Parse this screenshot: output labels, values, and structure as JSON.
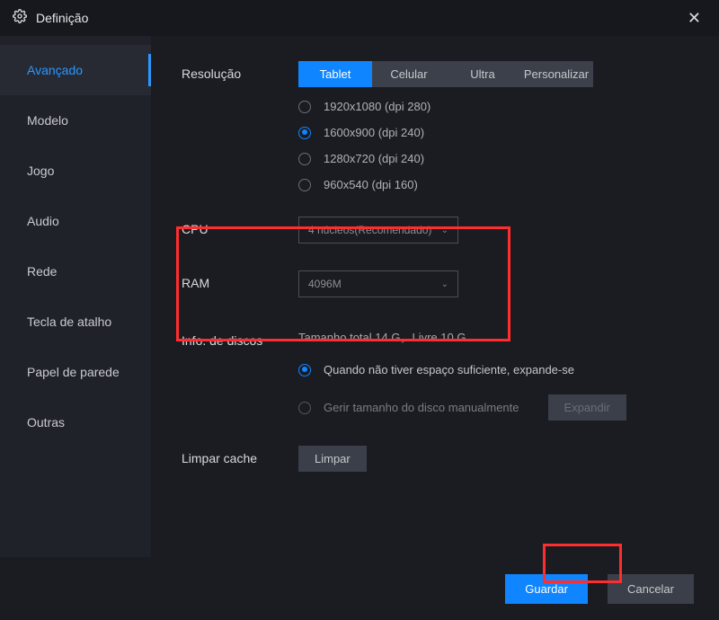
{
  "titlebar": {
    "title": "Definição"
  },
  "sidebar": {
    "items": [
      {
        "label": "Avançado",
        "active": true
      },
      {
        "label": "Modelo"
      },
      {
        "label": "Jogo"
      },
      {
        "label": "Audio"
      },
      {
        "label": "Rede"
      },
      {
        "label": "Tecla de atalho"
      },
      {
        "label": "Papel de parede"
      },
      {
        "label": "Outras"
      }
    ]
  },
  "resolution": {
    "label": "Resolução",
    "tabs": [
      {
        "label": "Tablet",
        "active": true
      },
      {
        "label": "Celular"
      },
      {
        "label": "Ultra"
      },
      {
        "label": "Personalizar"
      }
    ],
    "options": [
      {
        "label": "1920x1080  (dpi 280)",
        "checked": false
      },
      {
        "label": "1600x900  (dpi 240)",
        "checked": true
      },
      {
        "label": "1280x720  (dpi 240)",
        "checked": false
      },
      {
        "label": "960x540  (dpi 160)",
        "checked": false
      }
    ]
  },
  "cpu": {
    "label": "CPU",
    "value": "4 núcleos(Recomendado)"
  },
  "ram": {
    "label": "RAM",
    "value": "4096M"
  },
  "disk": {
    "label": "Info. de discos",
    "summary": "Tamanho total 14 G，Livre 10 G",
    "options": [
      {
        "label": "Quando não tiver espaço suficiente, expande-se",
        "checked": true
      },
      {
        "label": "Gerir tamanho do disco manualmente",
        "checked": false
      }
    ],
    "expand_btn": "Expandir"
  },
  "cache": {
    "label": "Limpar cache",
    "button": "Limpar"
  },
  "footer": {
    "save": "Guardar",
    "cancel": "Cancelar"
  }
}
